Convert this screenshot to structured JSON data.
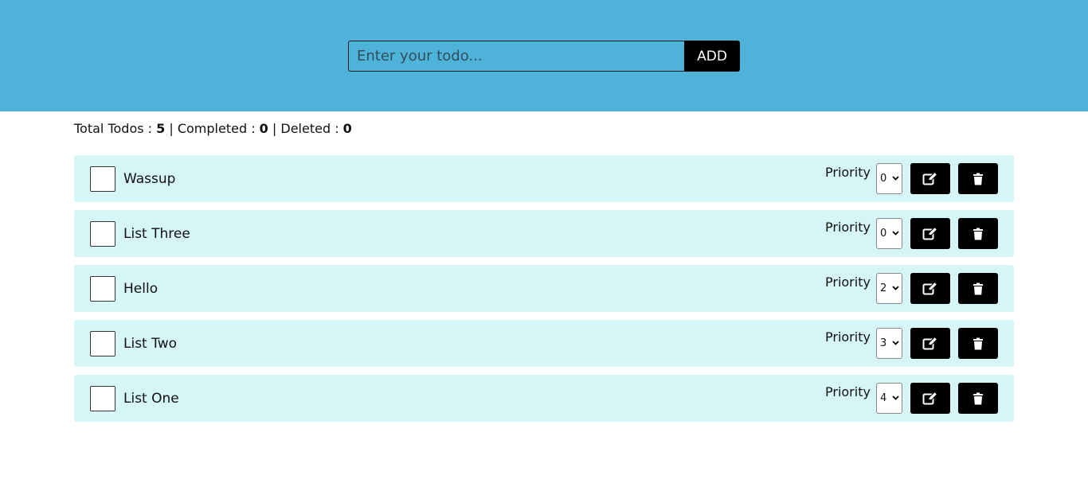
{
  "header": {
    "input_placeholder": "Enter your todo...",
    "input_value": "",
    "add_label": "ADD",
    "background_color": "#4fb3d9"
  },
  "stats": {
    "total_label": "Total Todos : ",
    "total": "5",
    "sep1": " | ",
    "completed_label": "Completed : ",
    "completed": "0",
    "sep2": " | ",
    "deleted_label": "Deleted : ",
    "deleted": "0"
  },
  "todos": [
    {
      "text": "Wassup",
      "priority_label": "Priority",
      "priority": "0",
      "checked": false
    },
    {
      "text": "List Three",
      "priority_label": "Priority",
      "priority": "0",
      "checked": false
    },
    {
      "text": "Hello",
      "priority_label": "Priority",
      "priority": "2",
      "checked": false
    },
    {
      "text": "List Two",
      "priority_label": "Priority",
      "priority": "3",
      "checked": false
    },
    {
      "text": "List One",
      "priority_label": "Priority",
      "priority": "4",
      "checked": false
    }
  ],
  "icons": {
    "edit": "edit-icon",
    "delete": "trash-icon",
    "dropdown": "chevron-down-icon"
  },
  "colors": {
    "row_background": "#d5f5f6",
    "button_background": "#000000"
  }
}
